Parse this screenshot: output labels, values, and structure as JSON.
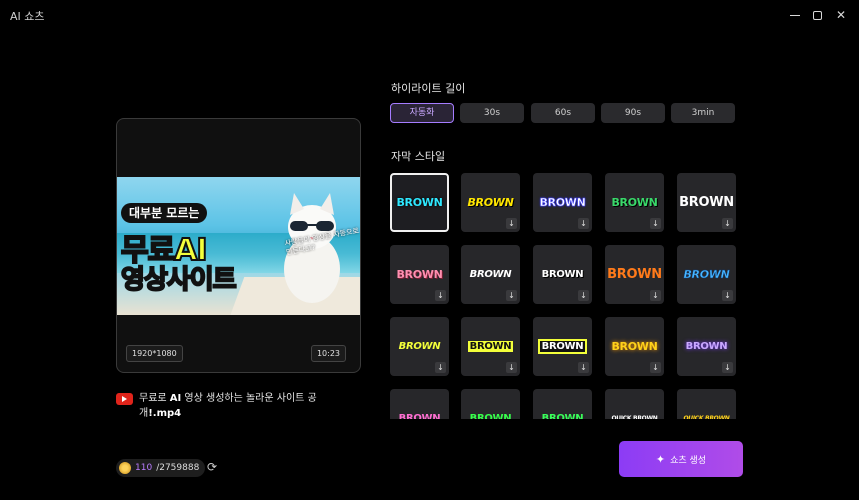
{
  "window": {
    "title": "AI 쇼츠",
    "minimize": "–",
    "maximize": "□",
    "close": "✕"
  },
  "preview": {
    "overlay_tag": "대부분 모르는",
    "overlay_big1": "무료AI",
    "overlay_big2": "영상사이트",
    "overlay_hand": "사람들이 영상을 자동으로 만든다고?",
    "resolution": "1920*1080",
    "duration": "10:23"
  },
  "file": {
    "name_pre": "무료로 ",
    "name_bold1": "AI",
    "name_mid": " 영상 생성하는 놀라운 사이트 공개",
    "name_bold2": "!.mp4"
  },
  "credits": {
    "used": "110",
    "total": "/2759888"
  },
  "highlight_length": {
    "label": "하이라이트 길이",
    "options": [
      "자동화",
      "30s",
      "60s",
      "90s",
      "3min"
    ],
    "selected_index": 0
  },
  "subtitle_style": {
    "label": "자막 스타일",
    "tiles": [
      {
        "text": "BROWN",
        "color": "#2ee8ff",
        "selected": true
      },
      {
        "text": "BROWN",
        "color": "#ffe600"
      },
      {
        "text": "BROWN",
        "color": "#ffffff"
      },
      {
        "text": "BROWN",
        "color": "#39d96a"
      },
      {
        "text": "BROWN",
        "color": "#ffffff"
      },
      {
        "text": "BROWN",
        "color": "#ff8fb0"
      },
      {
        "text": "BROWN",
        "color": "#ffffff"
      },
      {
        "text": "BROWN",
        "color": "#ffffff"
      },
      {
        "text": "BROWN",
        "color": "#ff7a1a"
      },
      {
        "text": "BROWN",
        "color": "#49b8ff"
      },
      {
        "text": "BROWN",
        "color": "#f3ff3a"
      },
      {
        "text": "BROWN",
        "color": "#111111"
      },
      {
        "text": "BROWN",
        "color": "#ffffff"
      },
      {
        "text": "BROWN",
        "color": "#ffd21a"
      },
      {
        "text": "BROWN",
        "color": "#c9a8ff"
      },
      {
        "text": "BROWN",
        "color": "#ff6fd2"
      },
      {
        "text": "BROWN",
        "color": "#37ff4b"
      },
      {
        "text": "BROWN",
        "color": "#39ff5a"
      },
      {
        "text": "QUICK BROWN",
        "color": "#ffffff"
      },
      {
        "text": "QUICK BROWN",
        "color": "#ffd21a"
      }
    ]
  },
  "generate_button": {
    "label": "쇼츠 생성",
    "icon": "sparkle-icon"
  }
}
